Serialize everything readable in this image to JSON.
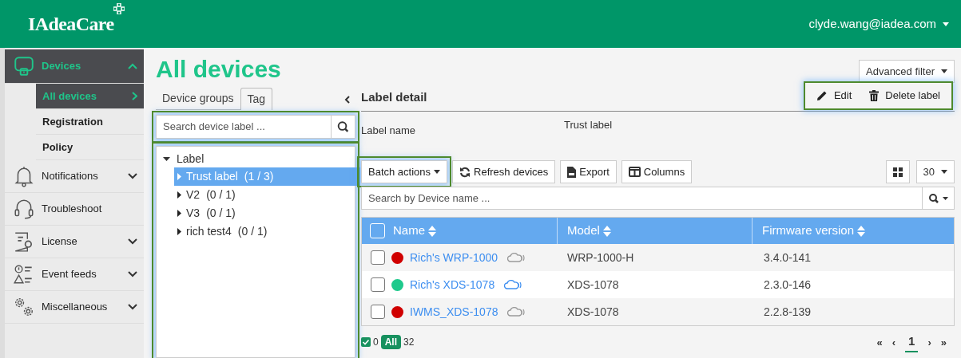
{
  "header": {
    "logo": "IAdeaCare",
    "user": "clyde.wang@iadea.com"
  },
  "sidebar": {
    "items": [
      {
        "label": "Devices",
        "selected": true,
        "expanded": true,
        "children": [
          {
            "label": "All devices",
            "selected": true
          },
          {
            "label": "Registration",
            "selected": false
          },
          {
            "label": "Policy",
            "selected": false
          }
        ]
      },
      {
        "label": "Notifications",
        "selected": false,
        "expanded": false
      },
      {
        "label": "Troubleshoot",
        "selected": false
      },
      {
        "label": "License",
        "selected": false,
        "expanded": false
      },
      {
        "label": "Event feeds",
        "selected": false,
        "expanded": false
      },
      {
        "label": "Miscellaneous",
        "selected": false,
        "expanded": false
      }
    ]
  },
  "page": {
    "title": "All devices"
  },
  "tabs": [
    {
      "label": "Device groups",
      "selected": false
    },
    {
      "label": "Tag",
      "selected": true
    }
  ],
  "label_search": {
    "placeholder": "Search device label ..."
  },
  "label_tree": {
    "label": "Label",
    "expanded": true,
    "children": [
      {
        "name": "Trust label",
        "count": "(1 / 3)",
        "selected": true
      },
      {
        "name": "V2",
        "count": "(0 / 1)",
        "selected": false
      },
      {
        "name": "V3",
        "count": "(0 / 1)",
        "selected": false
      },
      {
        "name": "rich test4",
        "count": "(0 / 1)",
        "selected": false
      }
    ]
  },
  "advanced_filter": "Advanced filter",
  "label_detail": {
    "title": "Label detail",
    "actions": [
      {
        "label": "Edit",
        "kind": "edit"
      },
      {
        "label": "Delete label",
        "kind": "delete"
      }
    ],
    "field_label": "Label name",
    "field_value": "Trust label"
  },
  "toolbar": {
    "buttons": [
      {
        "label": "Batch actions",
        "kind": "dropdown"
      },
      {
        "label": "Refresh devices",
        "kind": "refresh"
      },
      {
        "label": "Export",
        "kind": "export"
      },
      {
        "label": "Columns",
        "kind": "columns"
      }
    ],
    "page_size": "30"
  },
  "device_search": {
    "placeholder": "Search by Device name ..."
  },
  "table": {
    "all_checked": false,
    "columns": [
      "Name",
      "Model",
      "Firmware version"
    ],
    "rows": [
      {
        "checked": false,
        "color": "#d00000",
        "online": false,
        "name": "Rich's WRP-1000",
        "model": "WRP-1000-H",
        "firmware": "3.4.0-141"
      },
      {
        "checked": false,
        "color": "#1ec98c",
        "online": true,
        "name": "Rich's XDS-1078",
        "model": "XDS-1078",
        "firmware": "2.3.0-146"
      },
      {
        "checked": false,
        "color": "#d00000",
        "online": false,
        "name": "IWMS_XDS-1078",
        "model": "XDS-1078",
        "firmware": "2.2.8-139"
      }
    ]
  },
  "footer": {
    "selected_count": "0",
    "all_label": "All",
    "total": "32",
    "pager": [
      {
        "label": "«",
        "selected": false
      },
      {
        "label": "‹",
        "selected": false
      },
      {
        "label": "1",
        "selected": true
      },
      {
        "label": "›",
        "selected": false
      },
      {
        "label": "»",
        "selected": false
      }
    ]
  }
}
